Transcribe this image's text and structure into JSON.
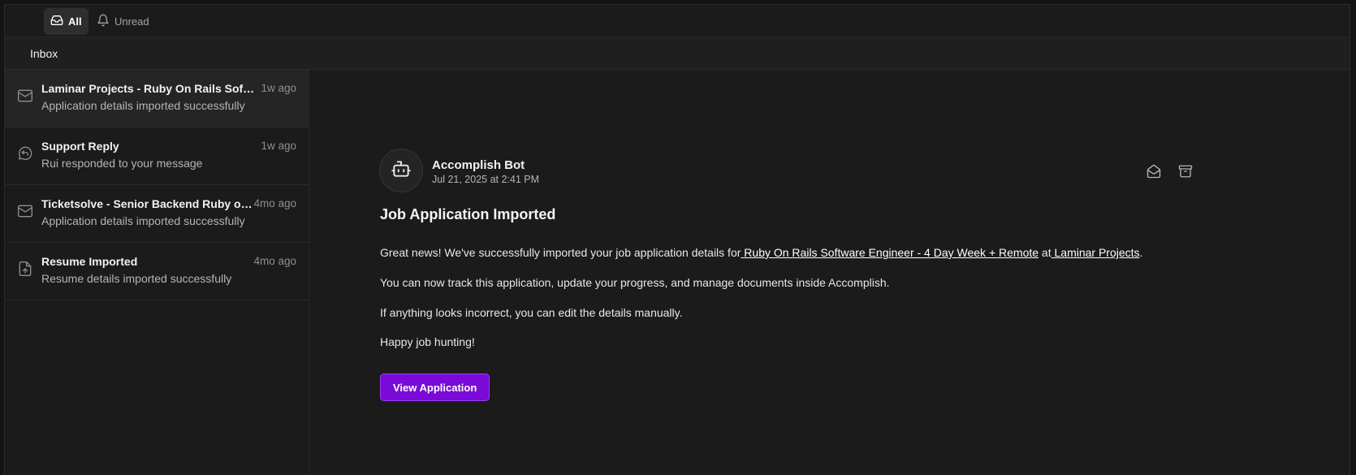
{
  "filters": {
    "all": "All",
    "unread": "Unread"
  },
  "inbox": {
    "title": "Inbox"
  },
  "messages": [
    {
      "title": "Laminar Projects - Ruby On Rails Softwa...",
      "time": "1w ago",
      "subtitle": "Application details imported successfully",
      "icon": "mail-icon"
    },
    {
      "title": "Support Reply",
      "time": "1w ago",
      "subtitle": "Rui responded to your message",
      "icon": "message-reply-icon"
    },
    {
      "title": "Ticketsolve - Senior Backend Ruby on ...",
      "time": "4mo ago",
      "subtitle": "Application details imported successfully",
      "icon": "mail-icon"
    },
    {
      "title": "Resume Imported",
      "time": "4mo ago",
      "subtitle": "Resume details imported successfully",
      "icon": "file-upload-icon"
    }
  ],
  "detail": {
    "sender": "Accomplish Bot",
    "date": "Jul 21, 2025 at 2:41 PM",
    "title": "Job Application Imported",
    "p1_before": "Great news! We've successfully imported your job application details for",
    "p1_link1": " Ruby On Rails Software Engineer - 4 Day Week + Remote",
    "p1_mid": " at",
    "p1_link2": " Laminar Projects",
    "p1_end": ".",
    "p2": "You can now track this application, update your progress, and manage documents inside Accomplish.",
    "p3": "If anything looks incorrect, you can edit the details manually.",
    "p4": "Happy job hunting!",
    "cta": "View Application"
  },
  "colors": {
    "accent": "#7a0bd6",
    "background": "#1b1b1c"
  }
}
